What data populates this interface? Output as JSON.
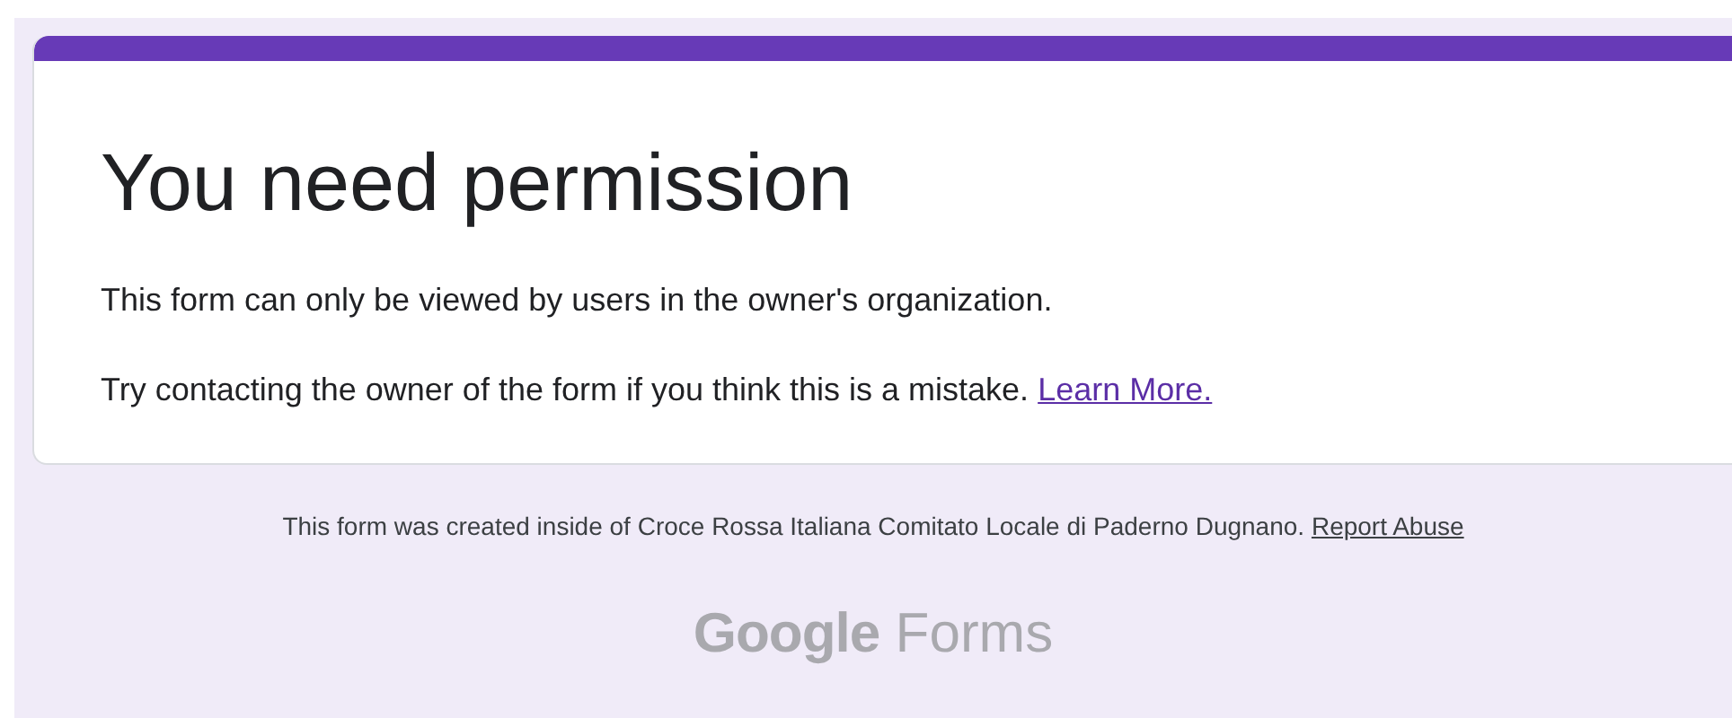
{
  "card": {
    "title": "You need permission",
    "messages": [
      "This form can only be viewed by users in the owner's organization."
    ],
    "hint": {
      "text": "Try contacting the owner of the form if you think this is a mistake.",
      "link": "Learn More."
    }
  },
  "footer": {
    "text": "This form was created inside of Croce Rossa Italiana Comitato Locale di Paderno Dugnano.",
    "link": "Report Abuse"
  },
  "logo": {
    "brand": "Google",
    "product": "Forms"
  }
}
